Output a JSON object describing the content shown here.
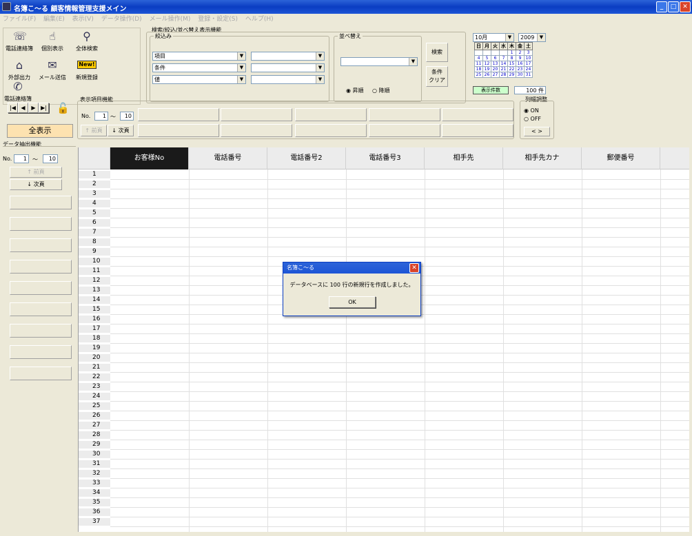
{
  "window": {
    "title": "名簿こ～る 顧客情報管理支援メイン",
    "min": "_",
    "max": "□",
    "close": "✕"
  },
  "menu": [
    "ファイル(F)",
    "編集(E)",
    "表示(V)",
    "データ操作(D)",
    "メール操作(M)",
    "登録・設定(S)",
    "ヘルプ(H)"
  ],
  "toolbar": {
    "phone": "電話連絡簿",
    "detail": "個別表示",
    "search_all": "全体検索",
    "export": "外部出力",
    "mail": "メール送信",
    "new_reg": "新規登録",
    "new_badge": "New!"
  },
  "filter": {
    "group_title": "検索/絞込/並べ替え表示機能",
    "narrow_title": "絞込み",
    "row1_label": "項目",
    "row2_label": "条件",
    "row3_label": "値",
    "sort_title": "並べ替え",
    "asc": "昇順",
    "desc": "降順",
    "search_btn": "検索",
    "clear_btn": "条件\nクリア"
  },
  "calendar": {
    "month": "10月",
    "year": "2009",
    "days": [
      "日",
      "月",
      "火",
      "水",
      "木",
      "金",
      "土"
    ],
    "dates": [
      "",
      "",
      "",
      "",
      "1",
      "2",
      "3",
      "4",
      "5",
      "6",
      "7",
      "8",
      "9",
      "10",
      "11",
      "12",
      "13",
      "14",
      "15",
      "16",
      "17",
      "18",
      "19",
      "20",
      "21",
      "22",
      "23",
      "24",
      "25",
      "26",
      "27",
      "28",
      "29",
      "30",
      "31"
    ]
  },
  "count": {
    "label": "表示件数",
    "value": "100 件"
  },
  "nav": {
    "first": "|◀",
    "prev": "◀",
    "next": "▶",
    "last": "▶|"
  },
  "display_items": {
    "title": "表示項目機能",
    "no_label": "No.",
    "from": "1",
    "tilde": "～",
    "to": "10",
    "prev": "↑ 前頁",
    "next": "↓ 次頁"
  },
  "column_adjust": {
    "title": "列幅調整",
    "on": "ON",
    "off": "OFF",
    "arrows": "< >"
  },
  "show_all": "全表示",
  "extract": {
    "title": "データ抽出機能",
    "no_label": "No.",
    "from": "1",
    "tilde": "～",
    "to": "10",
    "prev": "↑ 前頁",
    "next": "↓ 次頁"
  },
  "grid": {
    "columns": [
      "お客様No",
      "電話番号",
      "電話番号2",
      "電話番号3",
      "相手先",
      "相手先カナ",
      "郵便番号"
    ],
    "rows": [
      "1",
      "2",
      "3",
      "4",
      "5",
      "6",
      "7",
      "8",
      "9",
      "10",
      "11",
      "12",
      "13",
      "14",
      "15",
      "16",
      "17",
      "18",
      "19",
      "20",
      "21",
      "22",
      "23",
      "24",
      "25",
      "26",
      "27",
      "28",
      "29",
      "30",
      "31",
      "32",
      "33",
      "34",
      "35",
      "36",
      "37"
    ]
  },
  "dialog": {
    "title": "名簿こ～る",
    "message": "データベースに 100 行の新規行を作成しました。",
    "ok": "OK",
    "close": "✕"
  }
}
